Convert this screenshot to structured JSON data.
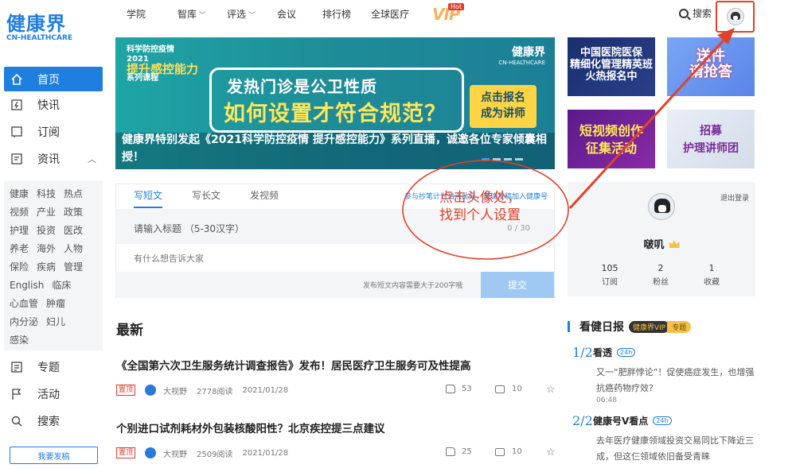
{
  "brand": {
    "name": "健康界",
    "sub": "CN-HEALTHCARE",
    "color": "#1e7fe0"
  },
  "sidebar": {
    "items": [
      {
        "label": "首页",
        "icon": "home-icon"
      },
      {
        "label": "快讯",
        "icon": "flash-icon"
      },
      {
        "label": "订阅",
        "icon": "subscribe-icon"
      },
      {
        "label": "资讯",
        "icon": "news-icon"
      }
    ],
    "tags": [
      [
        "健康",
        "科技",
        "热点"
      ],
      [
        "视频",
        "产业",
        "政策"
      ],
      [
        "护理",
        "投资",
        "医改"
      ],
      [
        "养老",
        "海外",
        "人物"
      ],
      [
        "保险",
        "疾病",
        "管理"
      ],
      [
        "English",
        "临床"
      ],
      [
        "心血管",
        "肿瘤"
      ],
      [
        "内分泌",
        "妇儿"
      ],
      [
        "感染"
      ]
    ],
    "lower": [
      {
        "label": "专题",
        "icon": "topic-icon"
      },
      {
        "label": "活动",
        "icon": "flag-icon"
      },
      {
        "label": "搜索",
        "icon": "search-icon"
      }
    ],
    "publish_label": "我要发稿"
  },
  "topnav": {
    "items": [
      "学院",
      "智库",
      "评选",
      "会议",
      "排行榜",
      "全球医疗"
    ],
    "vip": "VIP",
    "hot": "Hot",
    "search": "搜索"
  },
  "banner": {
    "small1": "科学防控疫情",
    "small2": "2021",
    "small3": "提升感控能力",
    "small4": "系列课程",
    "brand": "健康界",
    "brand_sub": "CN-HEALTHCARE",
    "line1": "发热门诊是公卫性质",
    "line2": "如何设置才符合规范？",
    "cta": "点击报名\n成为讲师",
    "caption": "健康界特别发起《2021科学防控疫情 提升感控能力》系列直播，诚邀各位专家倾囊相授！"
  },
  "thumbs": [
    {
      "text": "中国医院医保\n精细化管理精英班\n火热报名中"
    },
    {
      "text": "送件\n请抢答"
    },
    {
      "text": "短视频创作\n征集活动"
    },
    {
      "text": "招募\n护理讲师团"
    }
  ],
  "editor": {
    "tabs": [
      "写短文",
      "写长文",
      "发视频"
    ],
    "link": "参与抄笔计划请点此处，邀请发稿加入健康号",
    "title_placeholder": "请输入标题 （5-30汉字）",
    "count": "0 / 30",
    "body_placeholder": "有什么想告诉大家",
    "hint": "发布短文内容需要大于200字哦",
    "submit": "提交"
  },
  "feed": {
    "heading": "最新",
    "articles": [
      {
        "title": "《全国第六次卫生服务统计调查报告》发布！居民医疗卫生服务可及性提高",
        "pin": "置顶",
        "author": "大视野",
        "reads": "2778阅读",
        "date": "2021/01/28",
        "likes": "53",
        "comments": "10"
      },
      {
        "title": "个别进口试剂耗材外包装核酸阳性？北京疾控提三点建议",
        "pin": "置顶",
        "author": "大视野",
        "reads": "2509阅读",
        "date": "2021/01/28",
        "likes": "25",
        "comments": "10"
      }
    ]
  },
  "profile": {
    "logout": "退出登录",
    "name": "啵叽",
    "stats": [
      {
        "num": "105",
        "label": "订阅"
      },
      {
        "num": "2",
        "label": "粉丝"
      },
      {
        "num": "1",
        "label": "收藏"
      }
    ]
  },
  "daily": {
    "title": "看健日报",
    "badge": "健康界VIP",
    "badge2": "专题",
    "items": [
      {
        "num": "1/2",
        "label": "看透",
        "hrs": "24h",
        "text": "又一“肥胖悖论”！促使癌症发生，也增强抗癌药物疗效?",
        "time": "06:48"
      },
      {
        "num": "2/2",
        "label": "健康号V看点",
        "hrs": "24h",
        "text": "去年医疗健康领域投资交易同比下降近三成，但这仨领域依旧备受青睐",
        "time": ""
      }
    ]
  },
  "annotation": {
    "text_line1": "点击头像处，",
    "text_line2": "找到个人设置",
    "color": "#e0412c"
  }
}
